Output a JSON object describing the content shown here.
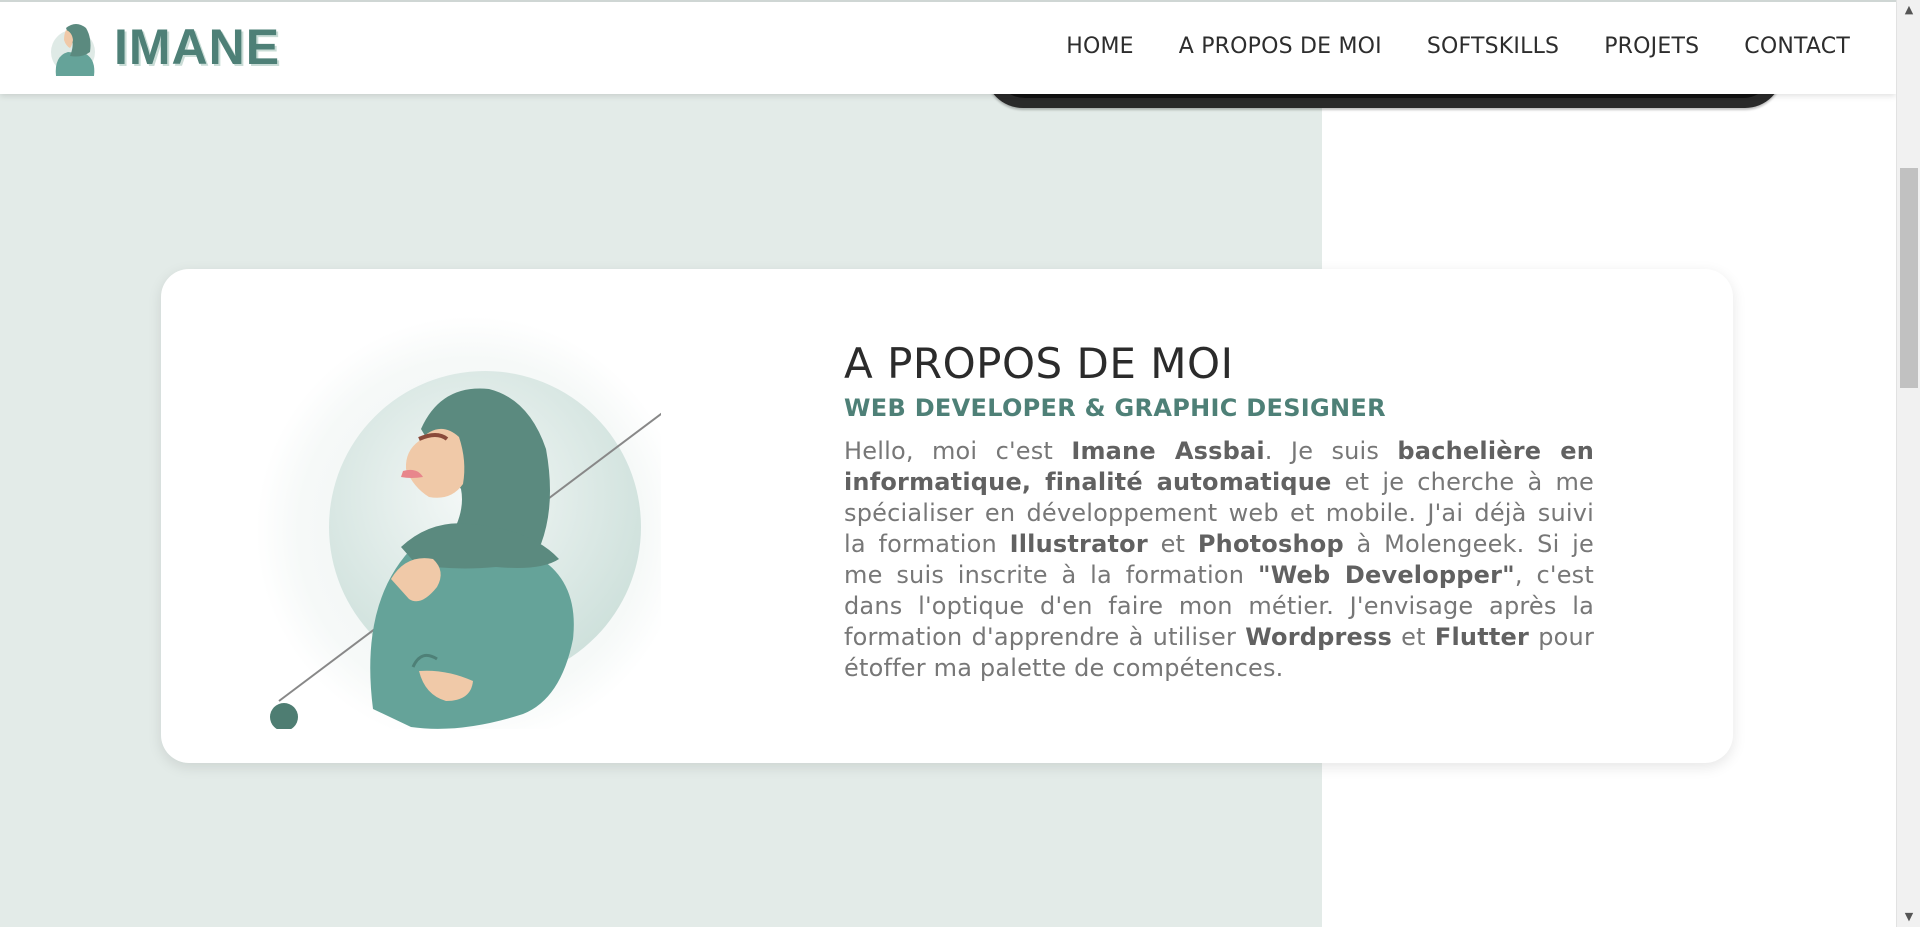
{
  "header": {
    "logo_text": "IMANE",
    "nav": [
      "HOME",
      "A PROPOS DE MOI",
      "SOFTSKILLS",
      "PROJETS",
      "CONTACT"
    ]
  },
  "about": {
    "title": "A PROPOS DE MOI",
    "subtitle": "WEB DEVELOPER & GRAPHIC DESIGNER",
    "paragraph": [
      {
        "text": "Hello, moi c'est ",
        "bold": false
      },
      {
        "text": "Imane Assbai",
        "bold": true
      },
      {
        "text": ". Je suis ",
        "bold": false
      },
      {
        "text": "bachelière en informatique, finalité automatique",
        "bold": true
      },
      {
        "text": " et je cherche à me spécialiser en développement web et mobile. J'ai déjà suivi la formation ",
        "bold": false
      },
      {
        "text": "Illustrator",
        "bold": true
      },
      {
        "text": " et ",
        "bold": false
      },
      {
        "text": "Photoshop",
        "bold": true
      },
      {
        "text": " à Molengeek. Si je me suis inscrite à la formation ",
        "bold": false
      },
      {
        "text": "\"Web Developper\"",
        "bold": true
      },
      {
        "text": ", c'est dans l'optique d'en faire mon métier. J'envisage après la formation d'apprendre à utiliser ",
        "bold": false
      },
      {
        "text": "Wordpress",
        "bold": true
      },
      {
        "text": " et ",
        "bold": false
      },
      {
        "text": "Flutter",
        "bold": true
      },
      {
        "text": " pour étoffer ma palette de compétences.",
        "bold": false
      }
    ]
  },
  "colors": {
    "accent": "#4e8077",
    "teal_light": "#e3ebe8",
    "hijab": "#5b8a7f",
    "clothes": "#65a399",
    "skin": "#f0c9a8"
  },
  "icons": {
    "scroll_up": "scroll-up-arrow-icon",
    "scroll_down": "scroll-down-arrow-icon"
  }
}
